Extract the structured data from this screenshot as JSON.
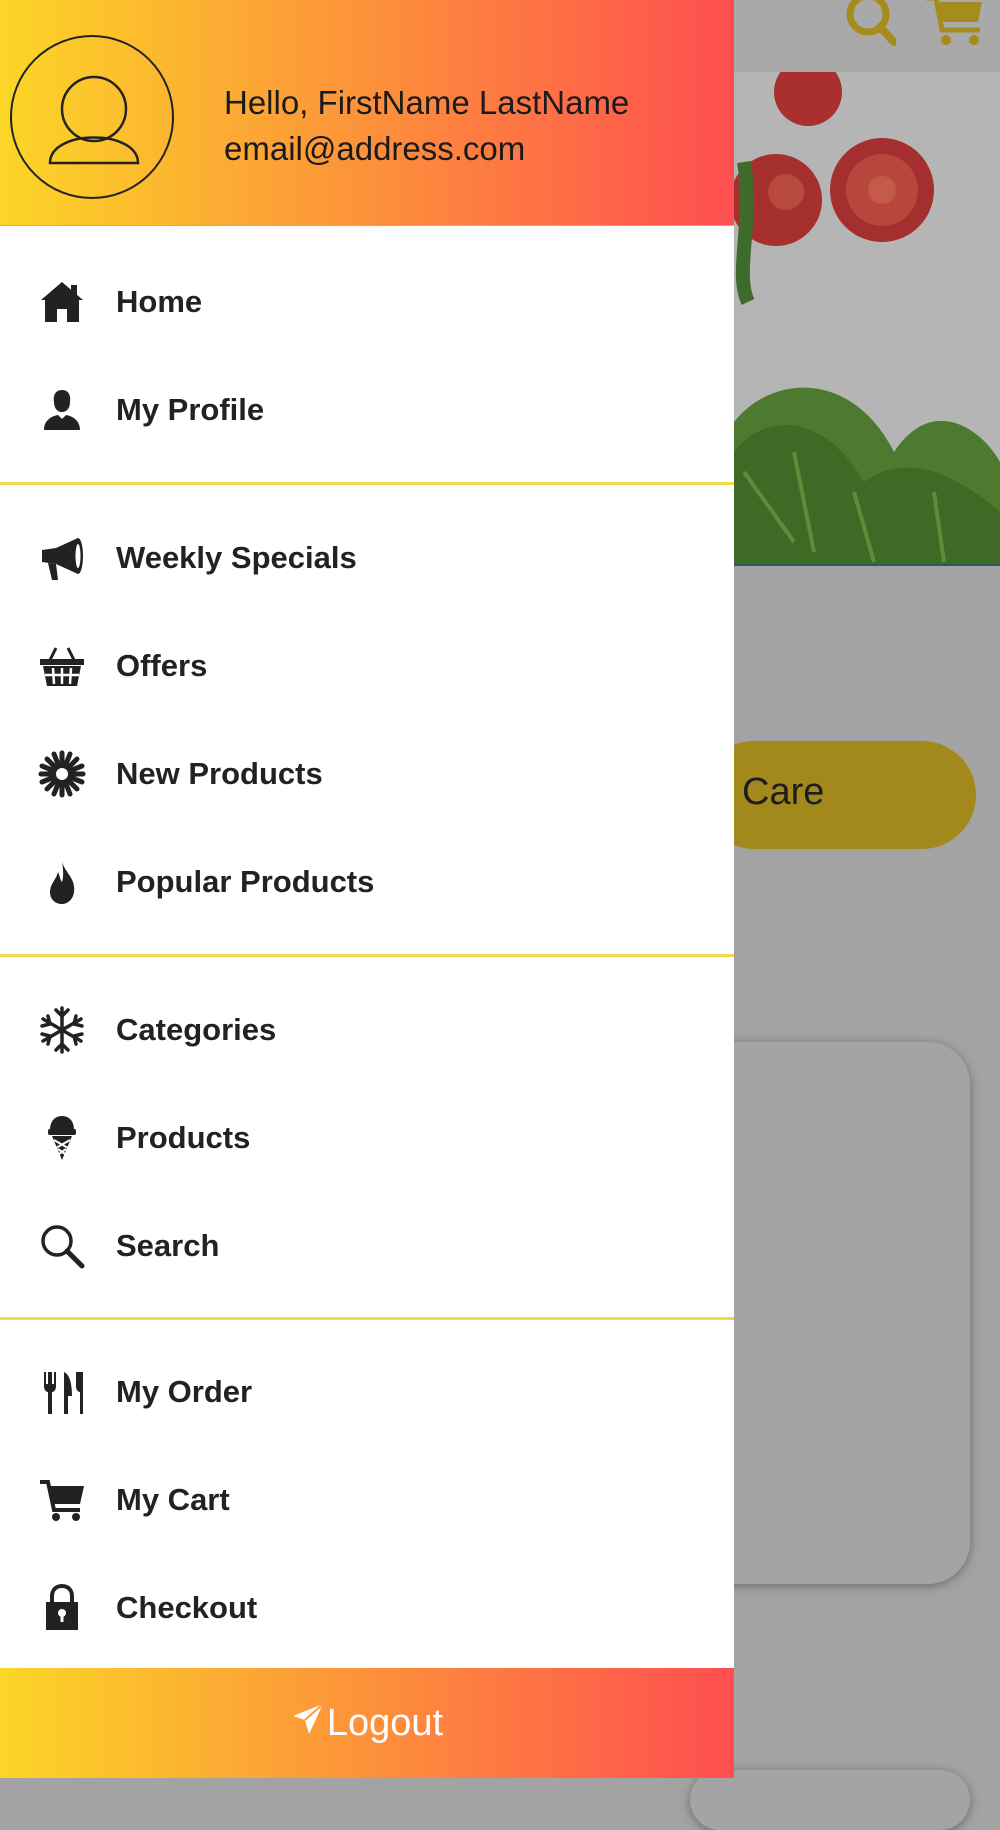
{
  "background": {
    "care_button_label": "Care"
  },
  "drawer": {
    "greeting": "Hello, FirstName LastName",
    "email": "email@address.com",
    "sections": [
      [
        {
          "label": "Home",
          "icon": "home-icon"
        },
        {
          "label": "My Profile",
          "icon": "person-icon"
        }
      ],
      [
        {
          "label": "Weekly Specials",
          "icon": "megaphone-icon"
        },
        {
          "label": "Offers",
          "icon": "basket-icon"
        },
        {
          "label": "New Products",
          "icon": "starburst-icon"
        },
        {
          "label": "Popular Products",
          "icon": "flame-icon"
        }
      ],
      [
        {
          "label": "Categories",
          "icon": "snowflake-icon"
        },
        {
          "label": "Products",
          "icon": "ice-cream-icon"
        },
        {
          "label": "Search",
          "icon": "search-icon"
        }
      ],
      [
        {
          "label": "My Order",
          "icon": "cutlery-icon"
        },
        {
          "label": "My Cart",
          "icon": "cart-icon"
        },
        {
          "label": "Checkout",
          "icon": "lock-icon"
        }
      ]
    ],
    "logout_label": "Logout"
  },
  "colors": {
    "gradient_start": "#fbd627",
    "gradient_end": "#fe4e51",
    "divider": "#f2d84b",
    "text": "#222222"
  }
}
